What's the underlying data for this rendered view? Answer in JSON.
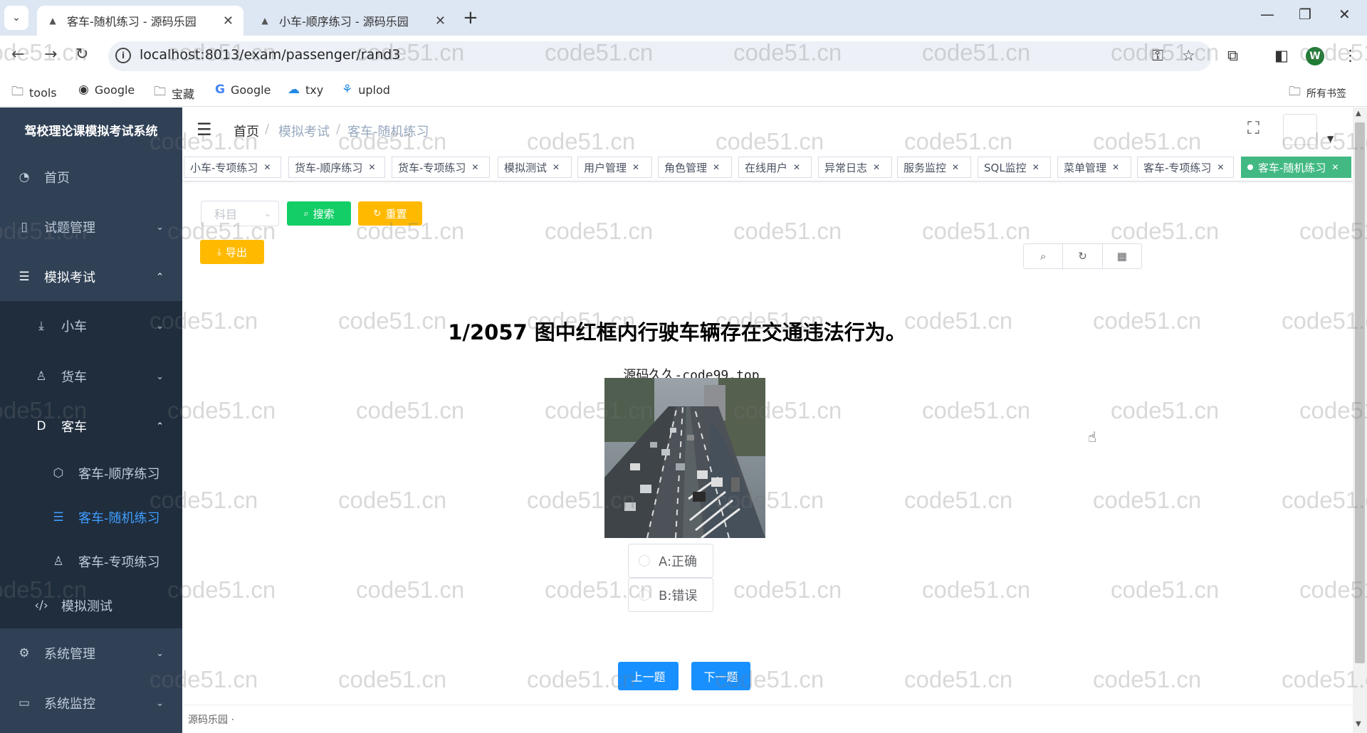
{
  "browser": {
    "tabs": [
      {
        "title": "客车-随机练习 - 源码乐园",
        "active": true
      },
      {
        "title": "小车-顺序练习 - 源码乐园",
        "active": false
      }
    ],
    "url": "localhost:8013/exam/passenger/rand3",
    "bookmarks": [
      "tools",
      "Google",
      "宝藏",
      "Google",
      "txy",
      "uplod"
    ],
    "all_bookmarks": "所有书签",
    "profile_initial": "W"
  },
  "sidebar": {
    "title": "驾校理论课模拟考试系统",
    "items": [
      {
        "label": "首页"
      },
      {
        "label": "试题管理"
      },
      {
        "label": "模拟考试"
      },
      {
        "label": "小车"
      },
      {
        "label": "货车"
      },
      {
        "label": "客车"
      },
      {
        "label": "客车-顺序练习"
      },
      {
        "label": "客车-随机练习"
      },
      {
        "label": "客车-专项练习"
      },
      {
        "label": "模拟测试"
      },
      {
        "label": "系统管理"
      },
      {
        "label": "系统监控"
      }
    ]
  },
  "breadcrumb": [
    "首页",
    "模拟考试",
    "客车-随机练习"
  ],
  "tags": [
    "小车-专项练习",
    "货车-顺序练习",
    "货车-专项练习",
    "模拟测试",
    "用户管理",
    "角色管理",
    "在线用户",
    "异常日志",
    "服务监控",
    "SQL监控",
    "菜单管理",
    "客车-专项练习",
    "客车-随机练习"
  ],
  "toolbar": {
    "subject_placeholder": "科目",
    "search_label": "搜索",
    "reset_label": "重置",
    "export_label": "导出"
  },
  "exam": {
    "question": "1/2057 图中红框内行驶车辆存在交通违法行为。",
    "image_caption": "源码久久-code99.top",
    "options": [
      "A:正确",
      "B:错误"
    ],
    "prev_label": "上一题",
    "next_label": "下一题"
  },
  "footer": "源码乐园 ·",
  "watermark": "code51.cn",
  "colors": {
    "sidebar": "#304156",
    "active_tag": "#42b983",
    "primary": "#1890ff",
    "success": "#13ce66",
    "warning": "#ffba00"
  }
}
